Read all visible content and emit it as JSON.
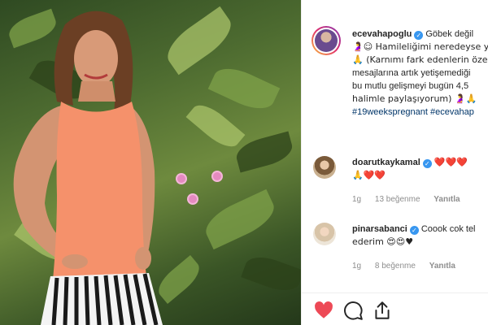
{
  "post": {
    "username": "ecevahapoglu",
    "caption_lines": [
      "Göbek değil",
      "🤰☺ Hamileliğimi neredeyse y",
      "🙏 (Karnımı fark edenlerin öze",
      "mesajlarına artık yetişemediği",
      "bu mutlu gelişmeyi bugün 4,5",
      "halimle paylaşıyorum) 🤰🙏"
    ],
    "hashtags": "#19weekspregnant #ecevahap"
  },
  "comments": [
    {
      "username": "doarutkaykamal",
      "text_line1": "❤️❤️❤️",
      "text_line2": "🙏❤️❤️",
      "time": "1g",
      "likes": "13 beğenme",
      "reply": "Yanıtla"
    },
    {
      "username": "pinarsabanci",
      "text_line1": "Coook cok tel",
      "text_line2": "ederim 😍😍♥",
      "time": "1g",
      "likes": "8 beğenme",
      "reply": "Yanıtla"
    }
  ],
  "colors": {
    "verified": "#3897f0",
    "like": "#ed4956",
    "hashtag": "#003569",
    "meta": "#8e8e8e"
  },
  "icons": {
    "verified": "verified-badge-icon",
    "like": "heart-icon",
    "comment": "comment-bubble-icon",
    "share": "share-icon",
    "comment_like": "small-heart-icon"
  }
}
